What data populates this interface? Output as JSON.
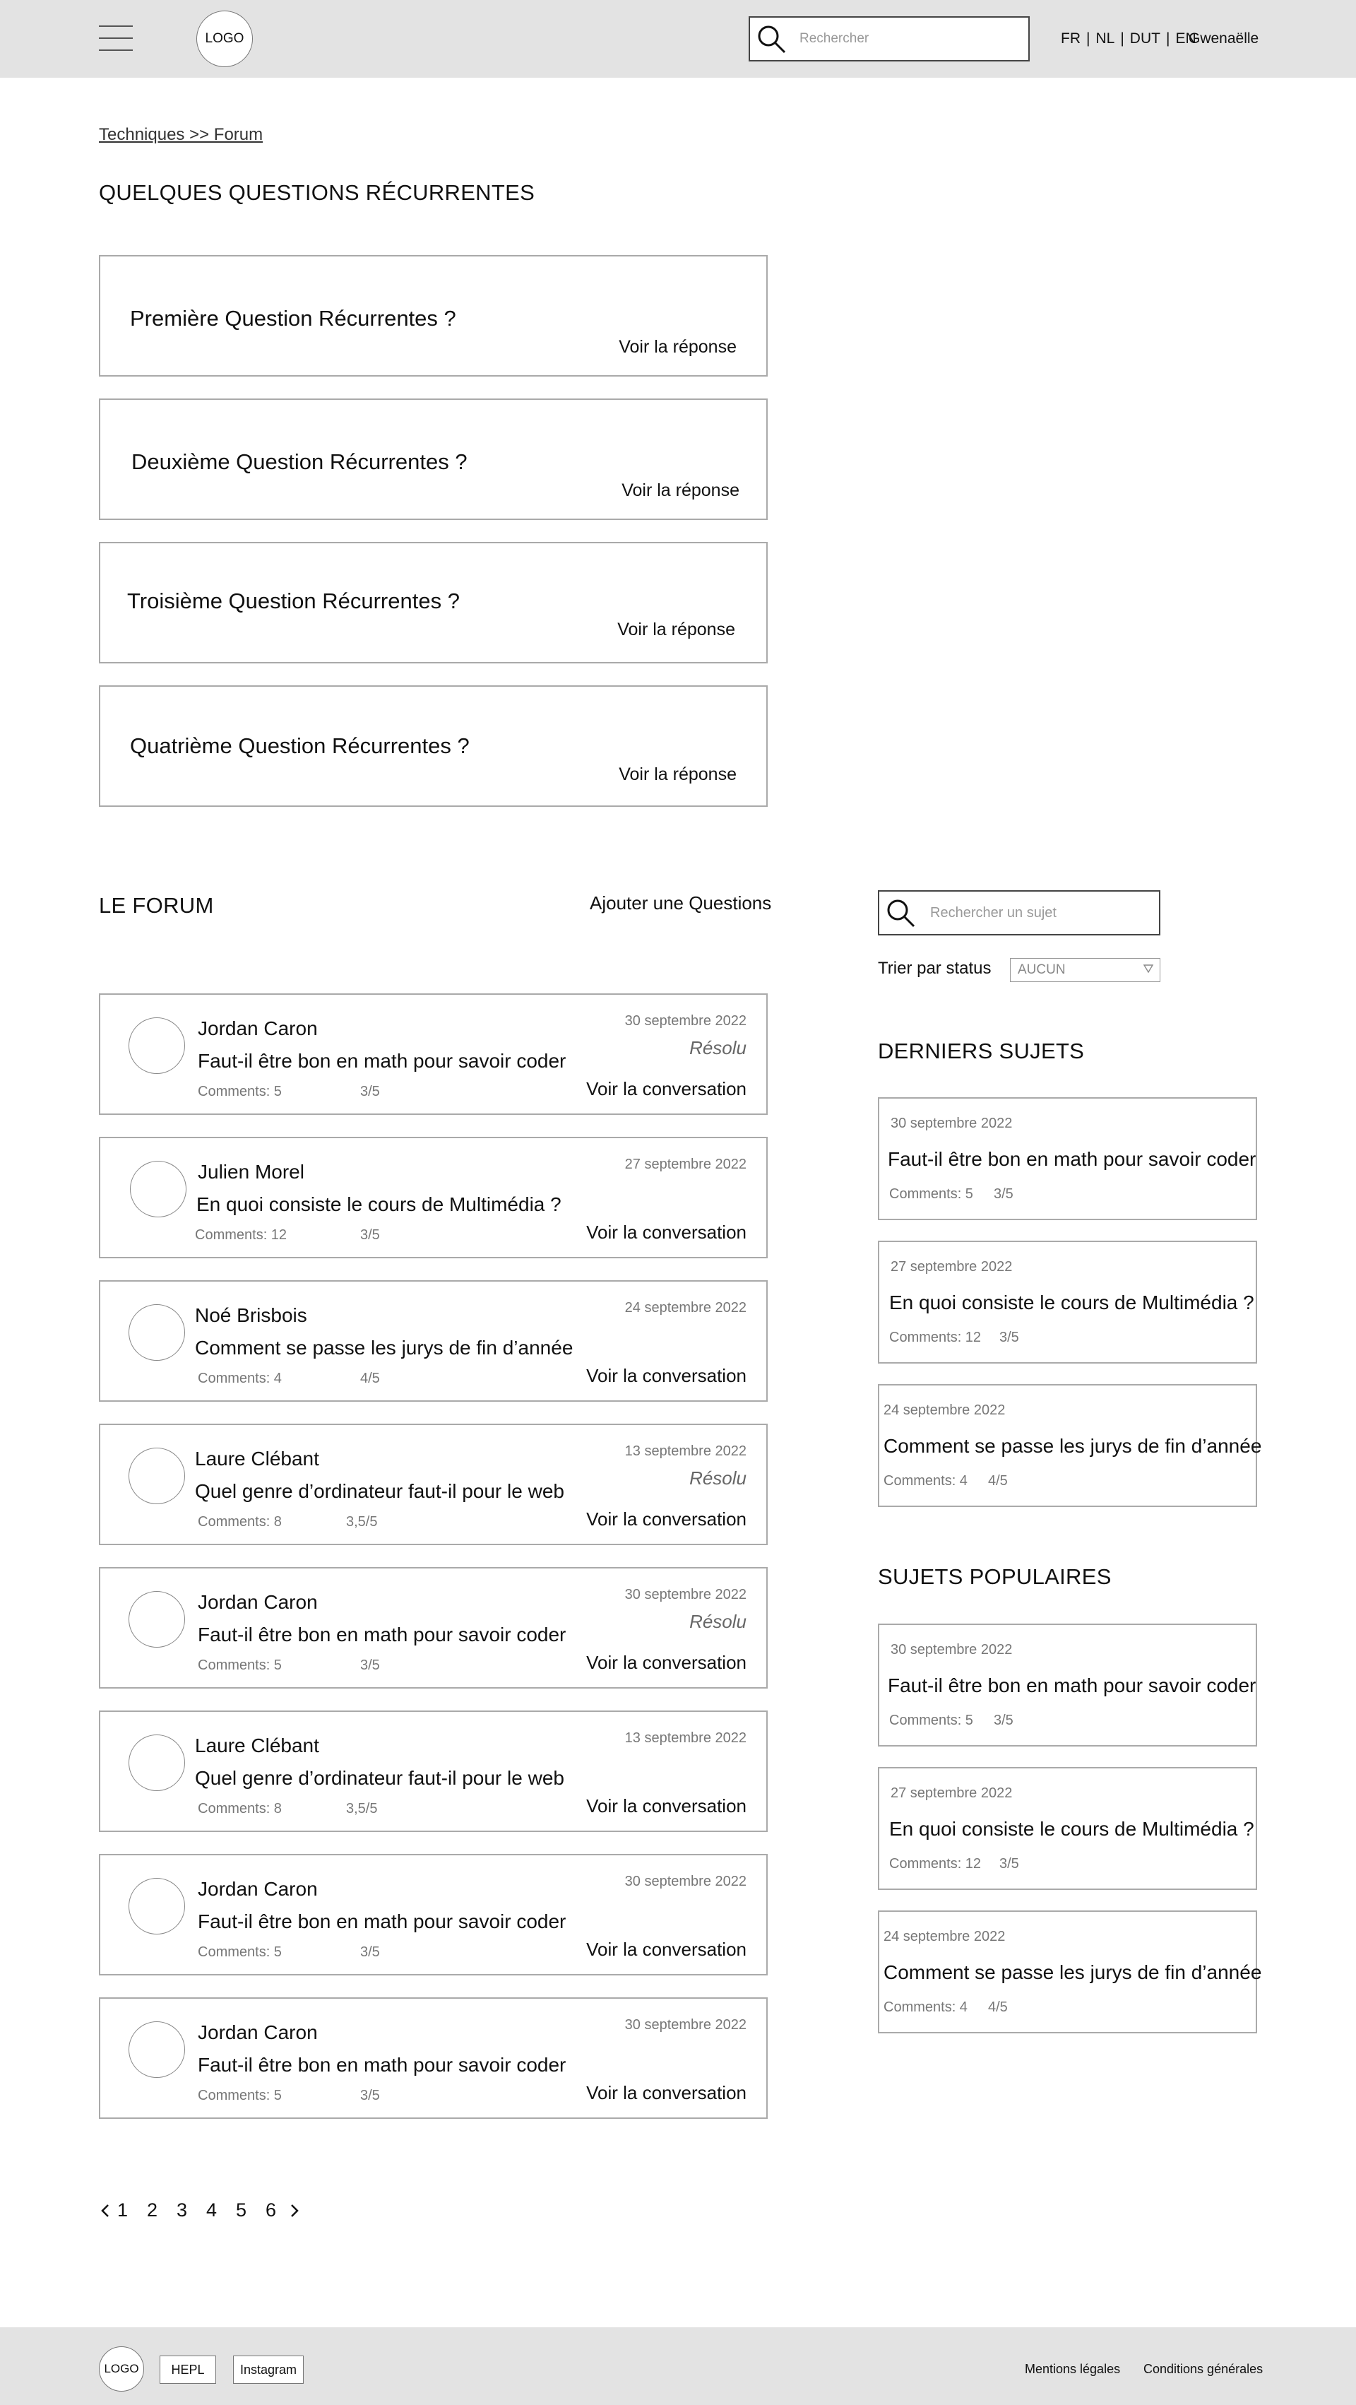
{
  "header": {
    "logo": "LOGO",
    "search_placeholder": "Rechercher",
    "languages": [
      "FR",
      "NL",
      "DUT",
      "EN"
    ],
    "user": "Gwenaëlle"
  },
  "breadcrumb": "Techniques >> Forum",
  "faq": {
    "title": "QUELQUES QUESTIONS RÉCURRENTES",
    "link_label": "Voir la réponse",
    "items": [
      "Première Question Récurrentes ?",
      "Deuxième Question Récurrentes ?",
      "Troisième Question Récurrentes ?",
      "Quatrième Question Récurrentes ?"
    ]
  },
  "forum": {
    "title": "LE FORUM",
    "add_question": "Ajouter une Questions",
    "conversation_label": "Voir la conversation",
    "posts": [
      {
        "author": "Jordan Caron",
        "title": "Faut-il être bon en math pour savoir coder",
        "date": "30 septembre 2022",
        "status": "Résolu",
        "comments": "Comments: 5",
        "rating": "3/5"
      },
      {
        "author": "Julien Morel",
        "title": "En quoi consiste le cours de Multimédia ?",
        "date": "27 septembre 2022",
        "status": "",
        "comments": "Comments: 12",
        "rating": "3/5"
      },
      {
        "author": "Noé Brisbois",
        "title": "Comment se passe les jurys de fin d’année",
        "date": "24 septembre 2022",
        "status": "",
        "comments": "Comments: 4",
        "rating": "4/5"
      },
      {
        "author": "Laure Clébant",
        "title": "Quel genre d’ordinateur faut-il pour le web",
        "date": "13 septembre 2022",
        "status": "Résolu",
        "comments": "Comments: 8",
        "rating": "3,5/5"
      },
      {
        "author": "Jordan Caron",
        "title": "Faut-il être bon en math pour savoir coder",
        "date": "30 septembre 2022",
        "status": "Résolu",
        "comments": "Comments: 5",
        "rating": "3/5"
      },
      {
        "author": "Laure Clébant",
        "title": "Quel genre d’ordinateur faut-il pour le web",
        "date": "13 septembre 2022",
        "status": "",
        "comments": "Comments: 8",
        "rating": "3,5/5"
      },
      {
        "author": "Jordan Caron",
        "title": "Faut-il être bon en math pour savoir coder",
        "date": "30 septembre 2022",
        "status": "",
        "comments": "Comments: 5",
        "rating": "3/5"
      },
      {
        "author": "Jordan Caron",
        "title": "Faut-il être bon en math pour savoir coder",
        "date": "30 septembre 2022",
        "status": "",
        "comments": "Comments: 5",
        "rating": "3/5"
      }
    ]
  },
  "pagination": {
    "pages": [
      "1",
      "2",
      "3",
      "4",
      "5",
      "6"
    ]
  },
  "sidebar": {
    "search_placeholder": "Rechercher un sujet",
    "sort_label": "Trier par status",
    "sort_value": "AUCUN",
    "latest": {
      "title": "DERNIERS SUJETS",
      "items": [
        {
          "date": "30 septembre 2022",
          "title": "Faut-il être bon en math pour savoir coder",
          "comments": "Comments: 5",
          "rating": "3/5"
        },
        {
          "date": "27 septembre 2022",
          "title": "En quoi consiste le cours de Multimédia ?",
          "comments": "Comments: 12",
          "rating": "3/5"
        },
        {
          "date": "24 septembre 2022",
          "title": "Comment se passe les jurys de fin d’année",
          "comments": "Comments: 4",
          "rating": "4/5"
        }
      ]
    },
    "popular": {
      "title": "SUJETS POPULAIRES",
      "items": [
        {
          "date": "30 septembre 2022",
          "title": "Faut-il être bon en math pour savoir coder",
          "comments": "Comments: 5",
          "rating": "3/5"
        },
        {
          "date": "27 septembre 2022",
          "title": "En quoi consiste le cours de Multimédia ?",
          "comments": "Comments: 12",
          "rating": "3/5"
        },
        {
          "date": "24 septembre 2022",
          "title": "Comment se passe les jurys de fin d’année",
          "comments": "Comments: 4",
          "rating": "4/5"
        }
      ]
    }
  },
  "footer": {
    "logo": "LOGO",
    "buttons": [
      "HEPL",
      "Instagram"
    ],
    "links": [
      "Mentions légales",
      "Conditions générales"
    ]
  }
}
